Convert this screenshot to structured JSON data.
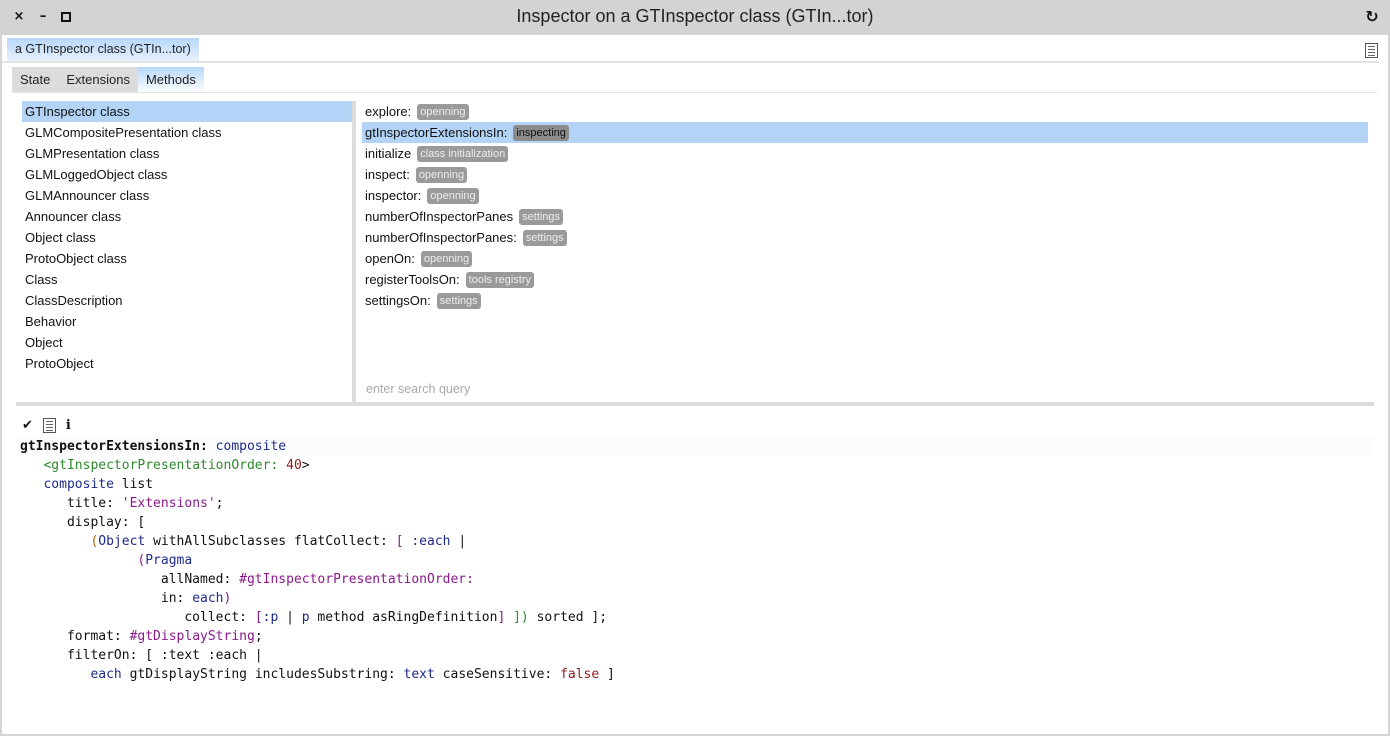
{
  "window": {
    "title": "Inspector on a GTInspector class (GTIn...tor)",
    "controls": {
      "close": "×",
      "minimize": "–",
      "refresh": "↻"
    }
  },
  "object_tab": {
    "label": "a GTInspector class (GTIn...tor)"
  },
  "tabs": [
    {
      "label": "State",
      "active": false
    },
    {
      "label": "Extensions",
      "active": false
    },
    {
      "label": "Methods",
      "active": true
    }
  ],
  "class_list": {
    "selected_index": 0,
    "items": [
      "GTInspector class",
      "GLMCompositePresentation class",
      "GLMPresentation class",
      "GLMLoggedObject class",
      "GLMAnnouncer class",
      "Announcer class",
      "Object class",
      "ProtoObject class",
      "Class",
      "ClassDescription",
      "Behavior",
      "Object",
      "ProtoObject"
    ]
  },
  "method_list": {
    "selected_index": 1,
    "items": [
      {
        "name": "explore:",
        "protocol": "openning"
      },
      {
        "name": "gtInspectorExtensionsIn:",
        "protocol": "inspecting"
      },
      {
        "name": "initialize",
        "protocol": "class initialization"
      },
      {
        "name": "inspect:",
        "protocol": "openning"
      },
      {
        "name": "inspector:",
        "protocol": "openning"
      },
      {
        "name": "numberOfInspectorPanes",
        "protocol": "settings"
      },
      {
        "name": "numberOfInspectorPanes:",
        "protocol": "settings"
      },
      {
        "name": "openOn:",
        "protocol": "openning"
      },
      {
        "name": "registerToolsOn:",
        "protocol": "tools registry"
      },
      {
        "name": "settingsOn:",
        "protocol": "settings"
      }
    ],
    "search": {
      "value": "",
      "placeholder": "enter search query"
    }
  },
  "editor_tools": {
    "accept": "✔",
    "info": "i"
  },
  "code": {
    "lines": [
      [
        {
          "t": "gtInspectorExtensionsIn: ",
          "c": "k-sel"
        },
        {
          "t": "composite",
          "c": "k-var"
        }
      ],
      [
        {
          "t": "   "
        },
        {
          "t": "<gtInspectorPresentationOrder: ",
          "c": "k-prag"
        },
        {
          "t": "40",
          "c": "k-num"
        },
        {
          "t": ">",
          "c": ""
        }
      ],
      [
        {
          "t": "   "
        },
        {
          "t": "composite",
          "c": "k-var"
        },
        {
          "t": " list"
        }
      ],
      [
        {
          "t": "      title: "
        },
        {
          "t": "'Extensions'",
          "c": "k-str"
        },
        {
          "t": ";"
        }
      ],
      [
        {
          "t": "      display: ["
        }
      ],
      [
        {
          "t": "         "
        },
        {
          "t": "(",
          "c": "k-par"
        },
        {
          "t": "Object",
          "c": "k-var"
        },
        {
          "t": " withAllSubclasses flatCollect: "
        },
        {
          "t": "[",
          "c": "k-br"
        },
        {
          "t": " :each",
          "c": "k-var"
        },
        {
          "t": " |"
        }
      ],
      [
        {
          "t": "               "
        },
        {
          "t": "(",
          "c": "k-br"
        },
        {
          "t": "Pragma",
          "c": "k-var"
        }
      ],
      [
        {
          "t": "                  allNamed: "
        },
        {
          "t": "#gtInspectorPresentationOrder:",
          "c": "k-sym"
        }
      ],
      [
        {
          "t": "                  in: "
        },
        {
          "t": "each",
          "c": "k-var"
        },
        {
          "t": ")",
          "c": "k-br"
        }
      ],
      [
        {
          "t": "                     collect: "
        },
        {
          "t": "[",
          "c": "k-br"
        },
        {
          "t": ":p",
          "c": "k-var"
        },
        {
          "t": " | "
        },
        {
          "t": "p",
          "c": "k-var"
        },
        {
          "t": " method asRingDefinition"
        },
        {
          "t": "]",
          "c": "k-br"
        },
        {
          "t": " "
        },
        {
          "t": "])",
          "c": "k-prag"
        },
        {
          "t": " sorted ];"
        }
      ],
      [
        {
          "t": "      format: "
        },
        {
          "t": "#gtDisplayString",
          "c": "k-sym"
        },
        {
          "t": ";"
        }
      ],
      [
        {
          "t": "      filterOn: [ :text :each |"
        }
      ],
      [
        {
          "t": "         "
        },
        {
          "t": "each",
          "c": "k-var"
        },
        {
          "t": " gtDisplayString includesSubstring: "
        },
        {
          "t": "text",
          "c": "k-var"
        },
        {
          "t": " caseSensitive: "
        },
        {
          "t": "false",
          "c": "k-false"
        },
        {
          "t": " ]"
        }
      ]
    ]
  }
}
